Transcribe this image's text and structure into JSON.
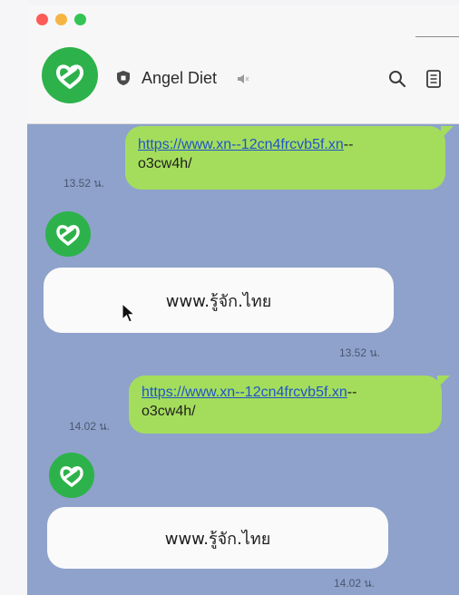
{
  "window": {
    "controls": [
      "close",
      "minimize",
      "zoom"
    ]
  },
  "header": {
    "title": "Angel Diet",
    "avatar_icon": "heart-logo-icon",
    "brand_color": "#2db24b"
  },
  "chat": {
    "background_color": "#8ea2cb",
    "messages": [
      {
        "direction": "outgoing",
        "line1": "https://www.xn--12cn4frcvb5f.xn",
        "line1_suffix": "--",
        "line2": "o3cw4h/",
        "time": "13.52 น."
      },
      {
        "direction": "incoming",
        "text": "www.รู้จัก.ไทย",
        "time": "13.52 น."
      },
      {
        "direction": "outgoing",
        "line1": "https://www.xn--12cn4frcvb5f.xn",
        "line1_suffix": "--",
        "line2": "o3cw4h/",
        "time": "14.02 น."
      },
      {
        "direction": "incoming",
        "text": "www.รู้จัก.ไทย",
        "time": "14.02 น."
      }
    ]
  },
  "colors": {
    "outgoing_bubble": "#a4dd5c",
    "incoming_bubble": "#fafafa",
    "link": "#1f55c8"
  }
}
